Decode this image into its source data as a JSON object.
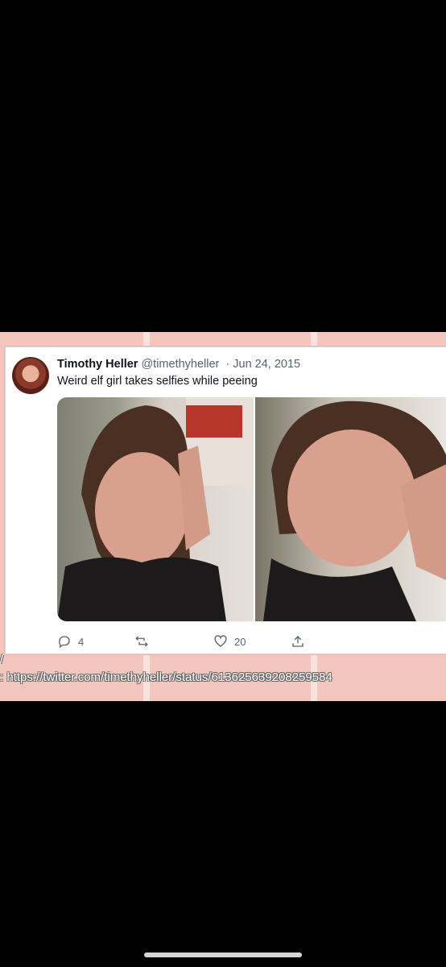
{
  "tweet": {
    "author_name": "Timothy Heller",
    "handle": "@timethyheller",
    "date": "· Jun 24, 2015",
    "text": "Weird elf girl takes selfies while peeing",
    "reply_count": "4",
    "like_count": "20"
  },
  "overlay": {
    "slash_mark": "/",
    "source_url": ": https://twitter.com/timethyheller/status/613625639208259584"
  },
  "colors": {
    "background": "#000000",
    "band": "#f2c6bd",
    "card": "#ffffff"
  },
  "icons": [
    "reply-icon",
    "retweet-icon",
    "like-icon",
    "share-icon"
  ]
}
